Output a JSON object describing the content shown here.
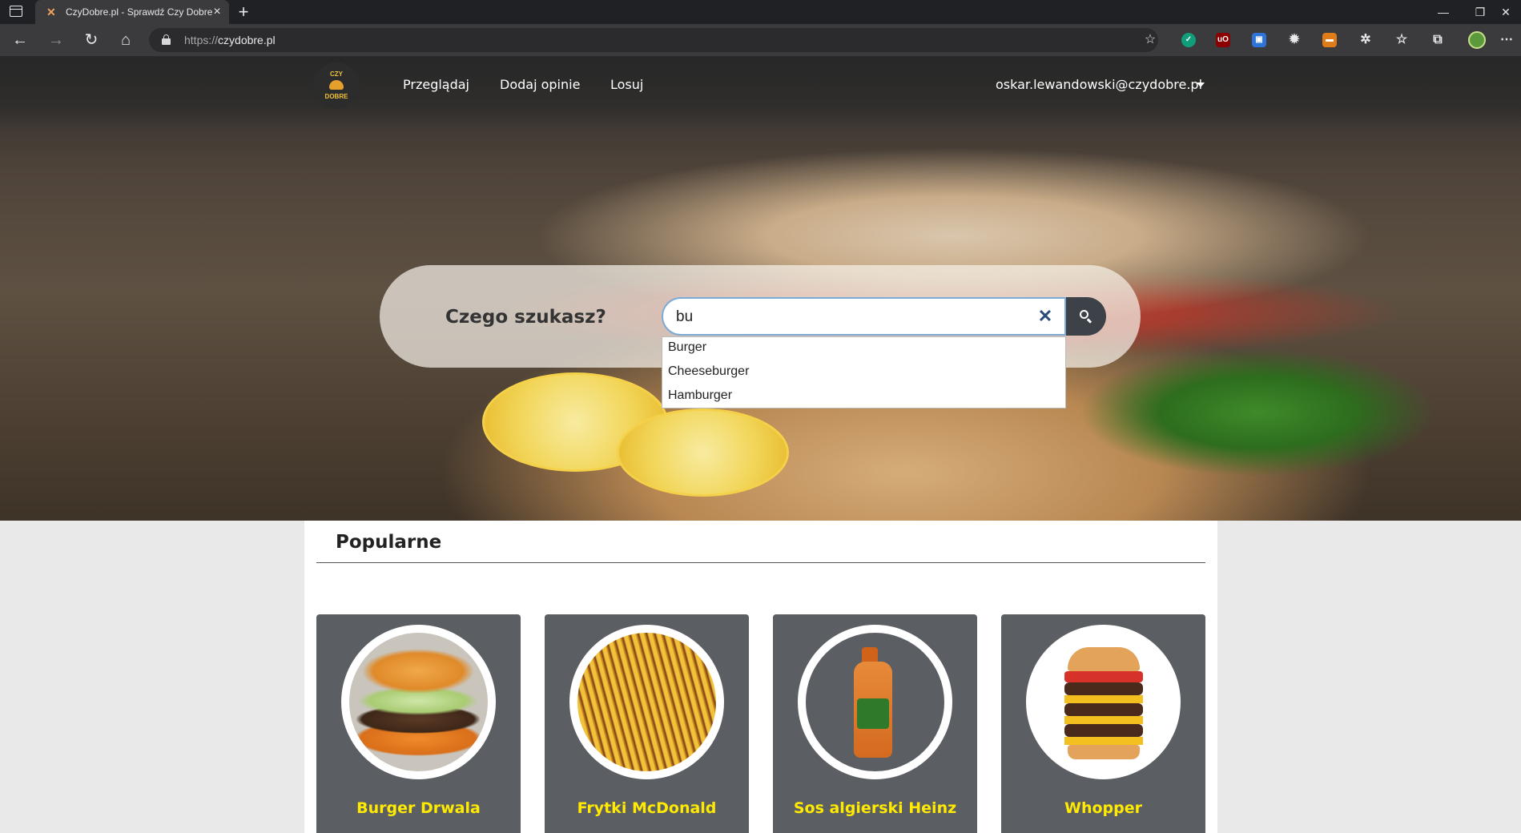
{
  "browser": {
    "tab_title": "CzyDobre.pl - Sprawdź Czy Dobre",
    "url_protocol": "https://",
    "url_domain": "czydobre.pl"
  },
  "site": {
    "logo_top": "CZY",
    "logo_bottom": "DOBRE",
    "nav": [
      "Przeglądaj",
      "Dodaj opinie",
      "Losuj"
    ],
    "user_email": "oskar.lewandowski@czydobre.pl"
  },
  "search": {
    "label": "Czego szukasz?",
    "value": "bu",
    "suggestions": [
      "Burger",
      "Cheeseburger",
      "Hamburger"
    ]
  },
  "popular": {
    "title": "Popularne",
    "cards": [
      {
        "name": "Burger Drwala"
      },
      {
        "name": "Frytki McDonald"
      },
      {
        "name": "Sos algierski Heinz"
      },
      {
        "name": "Whopper"
      }
    ]
  }
}
